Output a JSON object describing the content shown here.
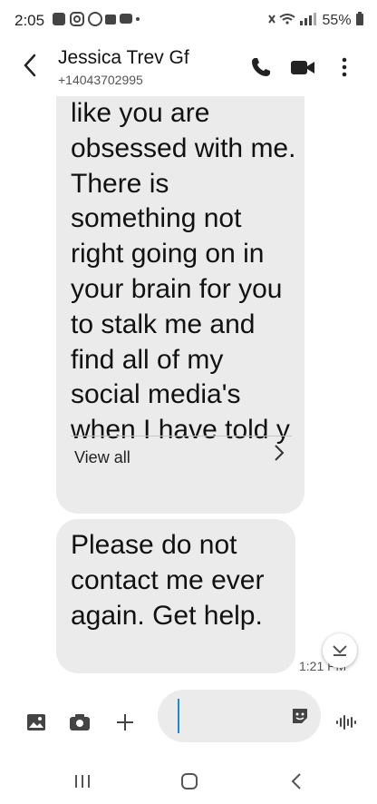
{
  "status_bar": {
    "time": "2:05",
    "battery": "55%"
  },
  "header": {
    "contact_name": "Jessica Trev Gf",
    "contact_number": "+14043702995"
  },
  "messages": [
    {
      "text": "like you are obsessed with me. There is something not right going on in your brain for you to stalk me and find all of my social media's when I have told y",
      "view_all_label": "View all"
    },
    {
      "text": "Please do not contact me ever again. Get help.",
      "timestamp": "1:21 PM"
    }
  ],
  "icons": {
    "back": "chevron-left-icon",
    "call": "phone-icon",
    "video": "video-camera-icon",
    "more": "more-vertical-icon",
    "gallery": "image-icon",
    "camera": "camera-icon",
    "add": "plus-icon",
    "sticker": "sticker-icon",
    "voice": "voice-wave-icon",
    "scroll_down": "scroll-down-icon"
  },
  "colors": {
    "bubble": "#ebebeb",
    "caret": "#1c8ad8"
  }
}
